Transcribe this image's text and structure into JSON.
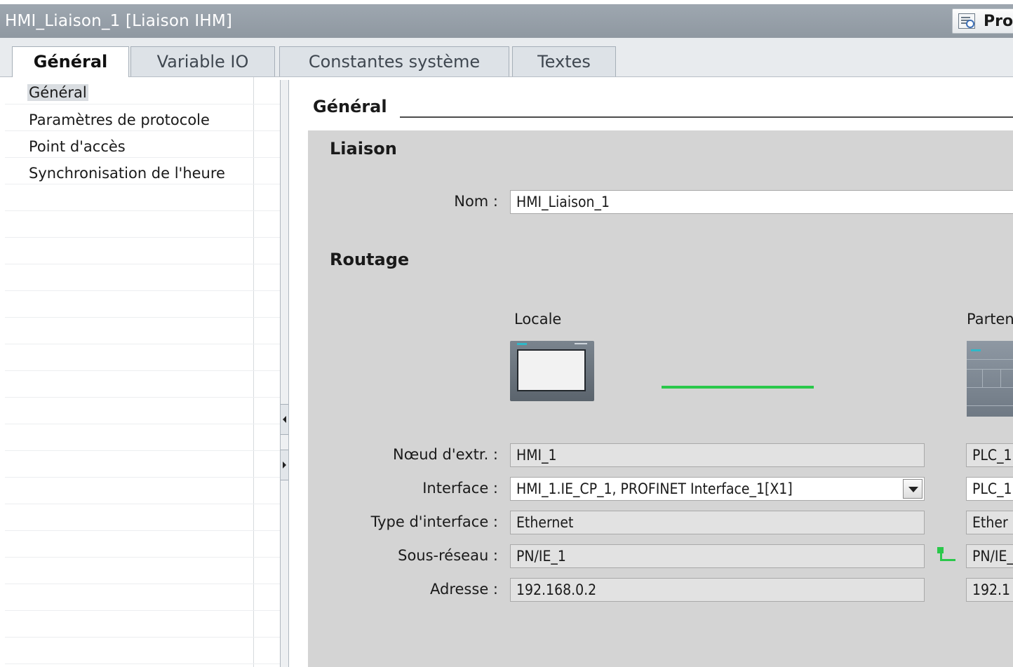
{
  "window": {
    "title": "HMI_Liaison_1 [Liaison IHM]",
    "properties_button": "Pro"
  },
  "tabs": [
    {
      "label": "Général"
    },
    {
      "label": "Variable IO"
    },
    {
      "label": "Constantes système"
    },
    {
      "label": "Textes"
    }
  ],
  "sidebar": {
    "items": [
      {
        "label": "Général"
      },
      {
        "label": "Paramètres de protocole"
      },
      {
        "label": "Point d'accès"
      },
      {
        "label": "Synchronisation de l'heure"
      }
    ]
  },
  "main": {
    "section_title": "Général",
    "liaison": {
      "title": "Liaison",
      "name_label": "Nom :",
      "name_value": "HMI_Liaison_1"
    },
    "routage": {
      "title": "Routage",
      "local_label": "Locale",
      "partner_label": "Parten",
      "rows": {
        "node": {
          "label": "Nœud d'extr. :",
          "local": "HMI_1",
          "partner": "PLC_1"
        },
        "interface": {
          "label": "Interface :",
          "local": "HMI_1.IE_CP_1, PROFINET Interface_1[X1]",
          "partner": "PLC_1"
        },
        "interface_type": {
          "label": "Type d'interface :",
          "local": "Ethernet",
          "partner": "Ether"
        },
        "subnet": {
          "label": "Sous-réseau :",
          "local": "PN/IE_1",
          "partner": "PN/IE_"
        },
        "address": {
          "label": "Adresse :",
          "local": "192.168.0.2",
          "partner": "192.1"
        }
      }
    }
  },
  "icons": {
    "properties": "properties-icon",
    "hmi_device": "hmi-device-icon",
    "plc_device": "plc-device-icon",
    "subnet": "subnet-icon",
    "collapse_left": "collapse-left-icon",
    "expand_right": "expand-right-icon",
    "dropdown": "chevron-down-icon"
  },
  "colors": {
    "title_bar": "#9aa3ac",
    "panel": "#d4d4d4",
    "connection": "#2ac84a"
  }
}
